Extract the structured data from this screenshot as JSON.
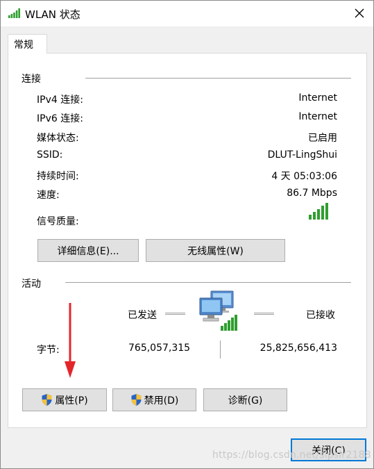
{
  "window": {
    "title": "WLAN 状态",
    "icon": "wifi-signal-icon",
    "close_glyph": "✕"
  },
  "tab": {
    "label": "常规"
  },
  "connection": {
    "group_title": "连接",
    "rows": [
      {
        "label": "IPv4 连接:",
        "value": "Internet"
      },
      {
        "label": "IPv6 连接:",
        "value": "Internet"
      },
      {
        "label": "媒体状态:",
        "value": "已启用"
      },
      {
        "label": "SSID:",
        "value": "DLUT-LingShui"
      },
      {
        "label": "持续时间:",
        "value": "4 天 05:03:06"
      },
      {
        "label": "速度:",
        "value": "86.7 Mbps"
      }
    ],
    "signal_label": "信号质量:",
    "signal_bars": 5,
    "details_button": "详细信息(E)...",
    "wireless_props_button": "无线属性(W)"
  },
  "activity": {
    "group_title": "活动",
    "sent_label": "已发送",
    "received_label": "已接收",
    "bytes_label": "字节:",
    "bytes_sent": "765,057,315",
    "bytes_received": "25,825,656,413"
  },
  "buttons": {
    "properties": "属性(P)",
    "disable": "禁用(D)",
    "diagnose": "诊断(G)",
    "close": "关闭(C)"
  },
  "colors": {
    "signal_green": "#2f9e2f",
    "arrow_red": "#e3262a",
    "accent_blue": "#0078d7"
  },
  "watermark": "https://blog.csdn.net/sipsir2188"
}
